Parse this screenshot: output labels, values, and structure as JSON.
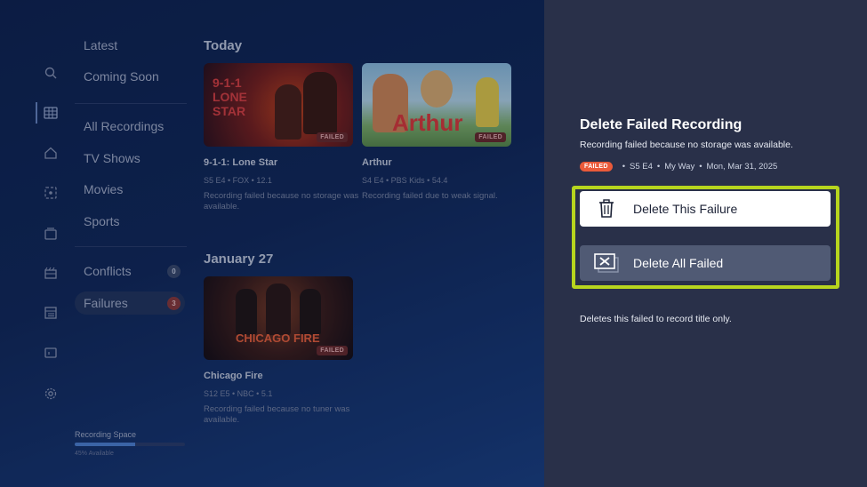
{
  "nav_menu": {
    "items": [
      {
        "label": "Latest"
      },
      {
        "label": "Coming Soon"
      },
      {
        "label": "All Recordings"
      },
      {
        "label": "TV Shows"
      },
      {
        "label": "Movies"
      },
      {
        "label": "Sports"
      },
      {
        "label": "Conflicts",
        "count": "0"
      },
      {
        "label": "Failures",
        "count": "3"
      }
    ],
    "selected": "Failures"
  },
  "icon_rail": [
    "search-icon",
    "grid-icon",
    "home-icon",
    "live-tv-icon",
    "folder-icon",
    "movies-icon",
    "guide-icon",
    "tv-icon",
    "settings-icon"
  ],
  "recording_space": {
    "label": "Recording Space",
    "available_text": "45% Available",
    "used_fraction": 0.55
  },
  "sections": [
    {
      "title": "Today",
      "cards": [
        {
          "title": "9-1-1: Lone Star",
          "meta": "S5 E4  •  FOX  •  12.1",
          "description": "Recording failed because no storage was available.",
          "tag": "FAILED",
          "thumb_label": "9-1-1 LONE STAR"
        },
        {
          "title": "Arthur",
          "meta": "S4 E4  •  PBS Kids  •  54.4",
          "description": "Recording failed due to weak signal.",
          "tag": "FAILED",
          "thumb_label": "Arthur"
        }
      ]
    },
    {
      "title": "January 27",
      "cards": [
        {
          "title": "Chicago Fire",
          "meta": "S12 E5  •  NBC  •  5.1",
          "description": "Recording failed because no tuner was available.",
          "tag": "FAILED",
          "thumb_label": "CHICAGO FIRE"
        }
      ]
    }
  ],
  "panel": {
    "title": "Delete Failed Recording",
    "subtitle": "Recording failed because no storage was available.",
    "status_tag": "FAILED",
    "episode": "S5 E4",
    "channel": "My Way",
    "date": "Mon, Mar 31, 2025",
    "buttons": {
      "delete_this": {
        "label": "Delete This Failure",
        "icon": "trash-icon"
      },
      "delete_all": {
        "label": "Delete All Failed",
        "icon": "delete-all-icon"
      }
    },
    "note": "Deletes this failed to record title only."
  },
  "colors": {
    "focus_ring": "#b7d51e",
    "failed_badge": "#ea5a3a",
    "panel_bg": "#293049"
  }
}
